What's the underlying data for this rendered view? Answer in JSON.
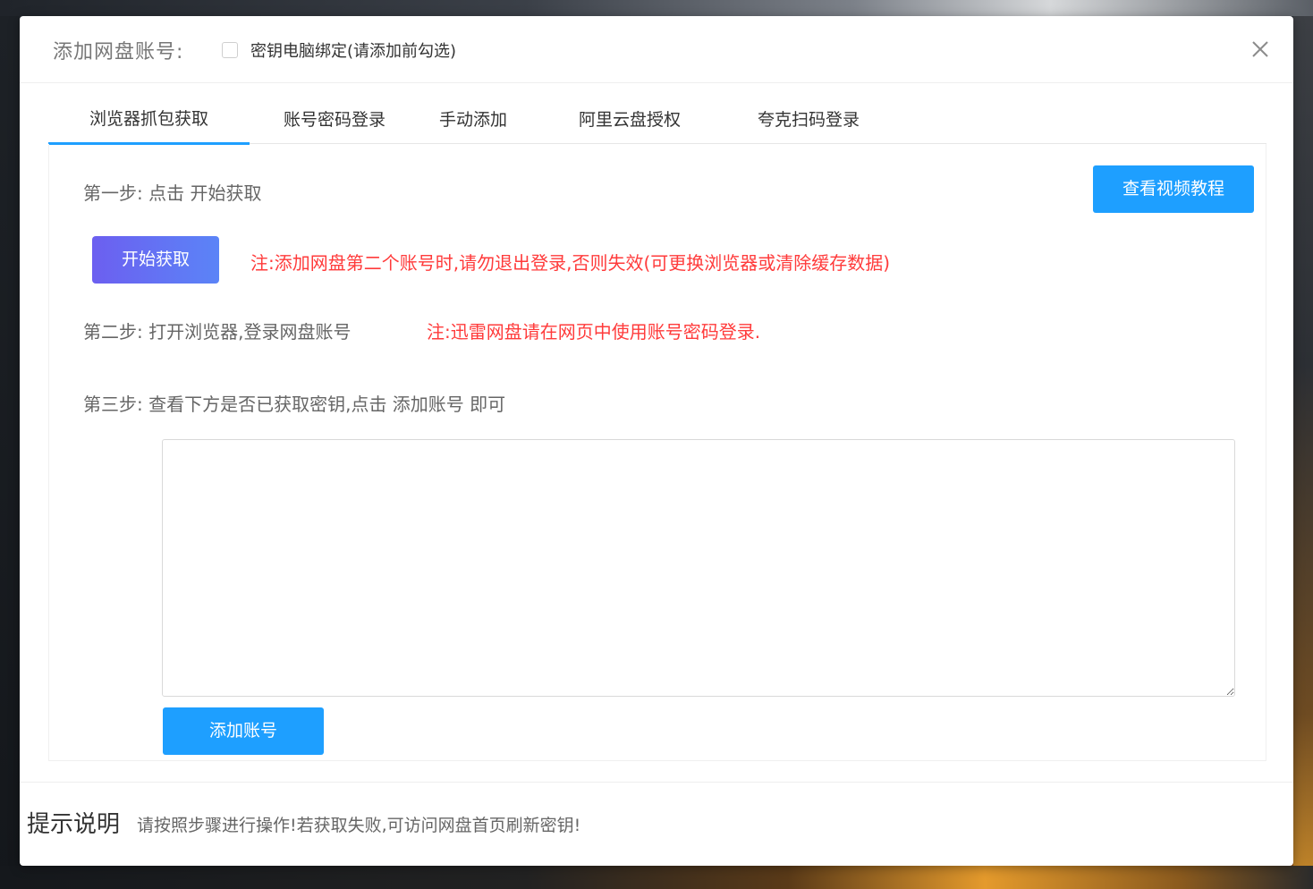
{
  "dialog": {
    "title": "添加网盘账号:",
    "bind_checkbox_label": "密钥电脑绑定(请添加前勾选)",
    "bind_checked": false
  },
  "tabs": [
    {
      "label": "浏览器抓包获取",
      "active": true
    },
    {
      "label": "账号密码登录",
      "active": false
    },
    {
      "label": "手动添加",
      "active": false
    },
    {
      "label": "阿里云盘授权",
      "active": false
    },
    {
      "label": "夸克扫码登录",
      "active": false
    }
  ],
  "panel": {
    "step1": "第一步: 点击 开始获取",
    "video_button": "查看视频教程",
    "start_button": "开始获取",
    "note1": "注:添加网盘第二个账号时,请勿退出登录,否则失效(可更换浏览器或清除缓存数据)",
    "step2": "第二步: 打开浏览器,登录网盘账号",
    "note2": "注:迅雷网盘请在网页中使用账号密码登录.",
    "step3": "第三步: 查看下方是否已获取密钥,点击 添加账号 即可",
    "key_textarea_value": "",
    "add_button": "添加账号"
  },
  "footer": {
    "title": "提示说明",
    "text": "请按照步骤进行操作!若获取失败,可访问网盘首页刷新密钥!"
  },
  "colors": {
    "primary": "#1e9fff",
    "start_gradient_from": "#6c5ff0",
    "start_gradient_to": "#5b84f7",
    "warning": "#ff3b3b",
    "text_muted": "#666666"
  }
}
